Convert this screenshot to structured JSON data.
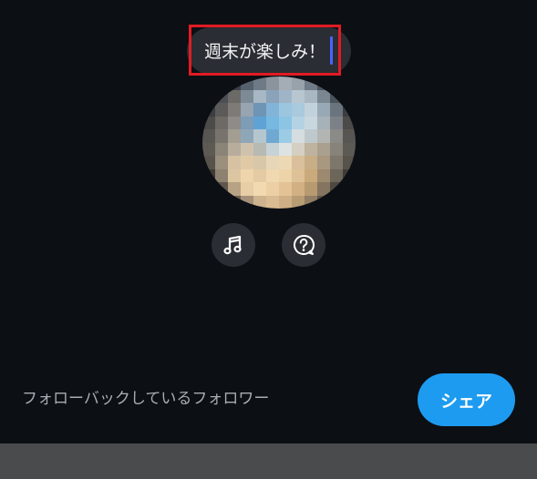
{
  "note": {
    "text": "週末が楽しみ！"
  },
  "actions": {
    "music_icon": "music-note-icon",
    "question_icon": "question-bubble-icon"
  },
  "footer": {
    "audience_label": "フォローバックしているフォロワー",
    "share_label": "シェア"
  },
  "colors": {
    "background": "#0c0f14",
    "highlight": "#e21b23",
    "caret": "#4a63ff",
    "share_button": "#1d9bf0",
    "icon_button": "#2a2d33"
  }
}
